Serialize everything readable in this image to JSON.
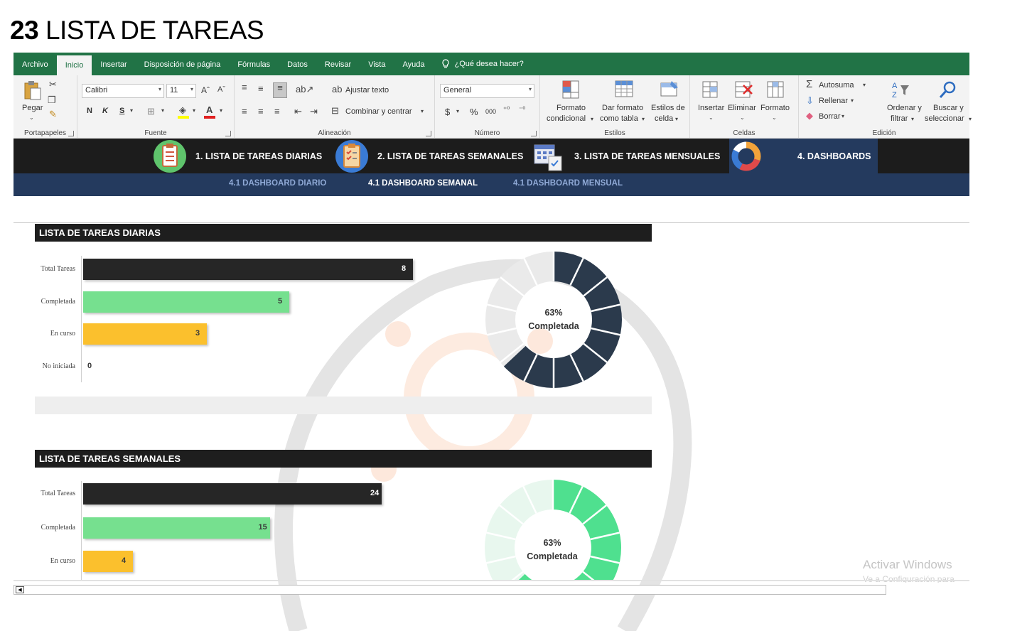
{
  "heading": {
    "number": "23",
    "title": "LISTA DE TAREAS"
  },
  "ribbon_tabs": [
    "Archivo",
    "Inicio",
    "Insertar",
    "Disposición de página",
    "Fórmulas",
    "Datos",
    "Revisar",
    "Vista",
    "Ayuda"
  ],
  "tell_me": "¿Qué desea hacer?",
  "ribbon": {
    "clipboard": {
      "paste": "Pegar",
      "label": "Portapapeles"
    },
    "font": {
      "name": "Calibri",
      "size": "11",
      "bold": "N",
      "italic": "K",
      "underline": "S",
      "label": "Fuente"
    },
    "alignment": {
      "wrap": "Ajustar texto",
      "merge": "Combinar y centrar",
      "label": "Alineación"
    },
    "number": {
      "format": "General",
      "currency": "$",
      "percent": "%",
      "thousands": "000",
      "label": "Número"
    },
    "styles": {
      "conditional_1": "Formato",
      "conditional_2": "condicional",
      "table_1": "Dar formato",
      "table_2": "como tabla",
      "cell_1": "Estilos de",
      "cell_2": "celda",
      "label": "Estilos"
    },
    "cells": {
      "insert": "Insertar",
      "delete": "Eliminar",
      "format": "Formato",
      "label": "Celdas"
    },
    "editing": {
      "autosum": "Autosuma",
      "fill": "Rellenar",
      "clear": "Borrar",
      "sort_1": "Ordenar y",
      "sort_2": "filtrar",
      "find_1": "Buscar y",
      "find_2": "seleccionar",
      "label": "Edición"
    }
  },
  "nav": {
    "items": [
      {
        "label": "1. LISTA DE TAREAS DIARIAS"
      },
      {
        "label": "2. LISTA DE TAREAS SEMANALES"
      },
      {
        "label": "3. LISTA DE TAREAS MENSUALES"
      },
      {
        "label": "4. DASHBOARDS"
      }
    ],
    "sub": [
      "4.1 DASHBOARD DIARIO",
      "4.1 DASHBOARD SEMANAL",
      "4.1 DASHBOARD MENSUAL"
    ]
  },
  "sections": {
    "daily": {
      "title": "LISTA DE TAREAS DIARIAS",
      "bars": [
        {
          "label": "Total Tareas",
          "value": 8,
          "color": "#262626"
        },
        {
          "label": "Completada",
          "value": 5,
          "color": "#76e08f"
        },
        {
          "label": "En curso",
          "value": 3,
          "color": "#fbc02d"
        },
        {
          "label": "No iniciada",
          "value": 0,
          "color": "#cccccc"
        }
      ],
      "donut": {
        "percent": "63%",
        "caption": "Completada",
        "fraction": 0.63,
        "color": "#2b3a4c",
        "track": "#eaeaea"
      }
    },
    "weekly": {
      "title": "LISTA DE TAREAS SEMANALES",
      "bars": [
        {
          "label": "Total Tareas",
          "value": 24,
          "color": "#262626"
        },
        {
          "label": "Completada",
          "value": 15,
          "color": "#76e08f"
        },
        {
          "label": "En curso",
          "value": 4,
          "color": "#fbc02d"
        }
      ],
      "donut": {
        "percent": "63%",
        "caption": "Completada",
        "fraction": 0.63,
        "color": "#4fe08f",
        "track": "#e8f7ee"
      }
    }
  },
  "watermark": {
    "line1": "Activar Windows",
    "line2": "Ve a Configuración para"
  }
}
